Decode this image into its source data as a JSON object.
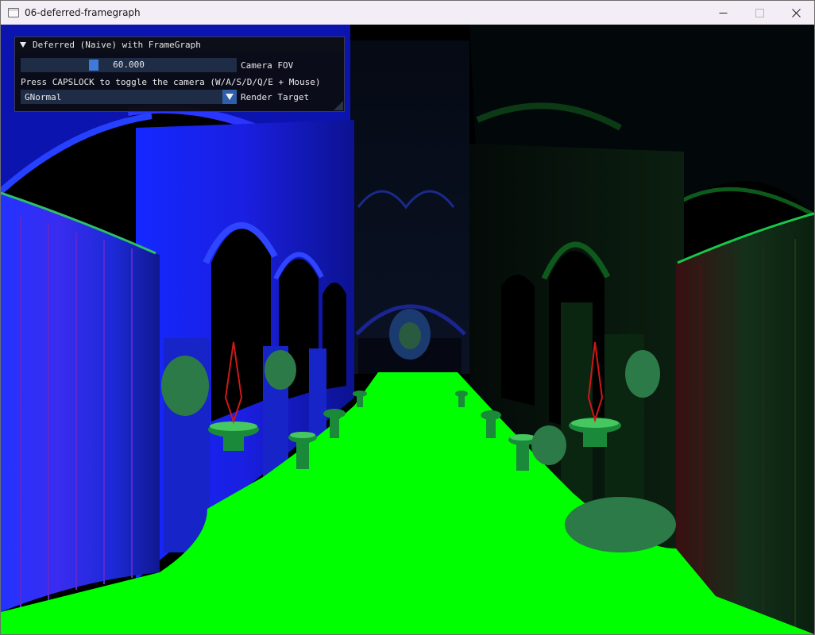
{
  "window": {
    "title": "06-deferred-framegraph",
    "minimize_glyph": "—",
    "maximize_glyph": "☐",
    "close_glyph": "✕"
  },
  "imgui": {
    "panel_title": "Deferred (Naive) with FrameGraph",
    "fov_value": "60.000",
    "fov_label": "Camera FOV",
    "help_text": "Press CAPSLOCK to toggle the camera (W/A/S/D/Q/E + Mouse)",
    "render_target_value": "GNormal",
    "render_target_label": "Render Target"
  },
  "colors": {
    "floor_normal": "#00ff00",
    "left_wall_normal": "#1a24ff",
    "right_wall_normal": "#0a3a12",
    "accent": "#3d7ad9"
  }
}
